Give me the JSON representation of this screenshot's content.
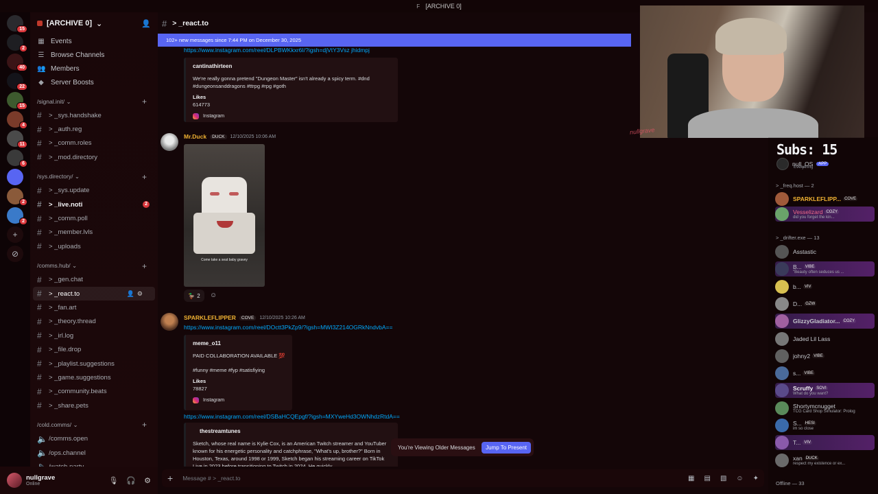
{
  "window": {
    "title": "[ARCHIVE 0]",
    "logo": "F"
  },
  "colors": {
    "accent": "#5865f2",
    "mention": "#da373c",
    "link": "#00a8fc"
  },
  "rail": {
    "servers": [
      {
        "badge": "15",
        "color": "#2a2a2e"
      },
      {
        "badge": "2",
        "color": "#1e1e22"
      },
      {
        "badge": "40",
        "color": "#3a1416"
      },
      {
        "badge": "22",
        "color": "#14141a"
      },
      {
        "badge": "15",
        "color": "#3d5a2e"
      },
      {
        "badge": "4",
        "color": "#7a3b2a"
      },
      {
        "badge": "11",
        "color": "#4a4a4a"
      },
      {
        "badge": "6",
        "color": "#3a3a3a"
      },
      {
        "badge": "",
        "color": "#5865f2"
      },
      {
        "badge": "2",
        "color": "#8a5a3a"
      },
      {
        "badge": "2",
        "color": "#3a7ac9"
      }
    ]
  },
  "sidebar": {
    "server_name": "[ARCHIVE 0]",
    "nav": [
      {
        "label": "Events",
        "icon": "calendar-icon"
      },
      {
        "label": "Browse Channels",
        "icon": "browse-icon"
      },
      {
        "label": "Members",
        "icon": "members-icon"
      },
      {
        "label": "Server Boosts",
        "icon": "boost-icon"
      }
    ],
    "categories": [
      {
        "name": "/signal.init/",
        "channels": [
          {
            "name": "> _sys.handshake",
            "type": "text"
          },
          {
            "name": "> _auth.reg",
            "type": "text"
          },
          {
            "name": "> _comm.roles",
            "type": "text"
          },
          {
            "name": "> _mod.directory",
            "type": "text"
          }
        ]
      },
      {
        "name": "/sys.directory/",
        "channels": [
          {
            "name": "> _sys.update",
            "type": "text"
          },
          {
            "name": "> _live.noti",
            "type": "text",
            "bold": true,
            "mention": "2"
          },
          {
            "name": "> _comm.poll",
            "type": "text"
          },
          {
            "name": "> _member.lvls",
            "type": "text"
          },
          {
            "name": "> _uploads",
            "type": "text"
          }
        ]
      },
      {
        "name": "/comms.hub/",
        "channels": [
          {
            "name": "> _gen.chat",
            "type": "text"
          },
          {
            "name": "> _react.to",
            "type": "text",
            "active": true
          },
          {
            "name": "> _fan.art",
            "type": "text"
          },
          {
            "name": "> _theory.thread",
            "type": "text"
          },
          {
            "name": "> _irl.log",
            "type": "text"
          },
          {
            "name": "> _file.drop",
            "type": "text"
          },
          {
            "name": "> _playlist.suggestions",
            "type": "text"
          },
          {
            "name": "> _game.suggestions",
            "type": "text"
          },
          {
            "name": "> _community.beats",
            "type": "text"
          },
          {
            "name": "> _share.pets",
            "type": "text"
          }
        ]
      },
      {
        "name": "/cold.comms/",
        "channels": [
          {
            "name": "/comms.open",
            "type": "voice"
          },
          {
            "name": "/ops.channel",
            "type": "voice"
          },
          {
            "name": "/watch.party",
            "type": "voice"
          }
        ]
      }
    ]
  },
  "user": {
    "name": "nullgrave",
    "status": "Online"
  },
  "chat": {
    "channel": "> _react.to",
    "new_banner": "102+ new messages since 7:44 PM on December 30, 2025",
    "composer_placeholder": "Message # > _react.to",
    "older_text": "You're Viewing Older Messages",
    "jump_label": "Jump To Present",
    "msg1": {
      "link": "https://www.instagram.com/reel/DLPBWKkxr6I/?igsh=djVtY3Vsz jhidmpj",
      "embed_author": "cantinathirteen",
      "embed_desc": "We're really gonna pretend \"Dungeon Master\" isn't already a spicy term. #dnd #dungeonsanddragons #ttrpg #rpg #goth",
      "field_name": "Likes",
      "field_value": "614773",
      "footer": "Instagram"
    },
    "msg2": {
      "author": "Mr.Duck",
      "tag": "DUCK",
      "time": "12/10/2025 10:06 AM",
      "caption": "Come take a seat baby gravey",
      "reaction_count": "2"
    },
    "msg3": {
      "author": "SPARKLEFLIPPER",
      "tag": "COVE",
      "time": "12/10/2025 10:26 AM",
      "link": "https://www.instagram.com/reel/DOctt3PkZp9/?igsh=MWI3Z214OGRkNndvbA==",
      "embed_author": "meme_o11",
      "embed_desc": "PAID COLLABORATION AVAILABLE 💯",
      "embed_desc2": "#funny #meme #fyp #satisfiying",
      "field_name": "Likes",
      "field_value": "78827",
      "footer": "Instagram",
      "link2": "https://www.instagram.com/reel/DSBaHCQEpgf/?igsh=MXYweHd3OWNhdzRtdA==",
      "embed2_author": "thestreamtunes",
      "embed2_desc": "Sketch, whose real name is Kylie Cox, is an American Twitch streamer and YouTuber known for his energetic personality and catchphrase, \"What's up, brother?\" Born in Houston, Texas, around 1998 or 1999, Sketch began his streaming career on TikTok Live in 2023 before transitioning to Twitch in 2024. He quickly"
    }
  },
  "overlay": {
    "subs_label": "Subs: 15",
    "watermark": "nullgrave"
  },
  "members": {
    "bot": {
      "name": "null_OS",
      "tag": "APP",
      "activity": "Everything"
    },
    "group1": "> _freq.host — 2",
    "host_members": [
      {
        "name": "SPARKLEFLIPP...",
        "tag": "COVE",
        "status": "",
        "color": "#f0b232",
        "bold": true,
        "hl": false,
        "av": "#a05a3a"
      },
      {
        "name": "Vesselizard",
        "tag": "COZY",
        "status": "did you forget the kin...",
        "color": "#f06a8a",
        "bold": false,
        "hl": true,
        "av": "#6aa36a"
      }
    ],
    "group2": "> _drifter.exe — 13",
    "drifter_members": [
      {
        "name": "Asstastic",
        "tag": "",
        "status": "",
        "color": "#c5c8cd",
        "bold": false,
        "hl": false,
        "av": "#555"
      },
      {
        "name": "B...",
        "tag": "VIBE",
        "status": "\"Beauty often seduces us ...",
        "color": "#c5c8cd",
        "bold": false,
        "hl": true,
        "av": "#3a3a5a"
      },
      {
        "name": "b...",
        "tag": "VIV",
        "status": "",
        "color": "#c5c8cd",
        "bold": false,
        "hl": false,
        "av": "#d8c050"
      },
      {
        "name": "D...",
        "tag": "GZW",
        "status": "",
        "color": "#c5c8cd",
        "bold": false,
        "hl": false,
        "av": "#888"
      },
      {
        "name": "GlizzyGladiator...",
        "tag": "COZY",
        "status": "",
        "color": "#c5c8cd",
        "bold": true,
        "hl": true,
        "av": "#a060a0"
      },
      {
        "name": "Jaded Lil Lass",
        "tag": "",
        "status": "",
        "color": "#c5c8cd",
        "bold": false,
        "hl": false,
        "av": "#777"
      },
      {
        "name": "johny2",
        "tag": "VIBE",
        "status": "",
        "color": "#c5c8cd",
        "bold": false,
        "hl": false,
        "av": "#606060"
      },
      {
        "name": "s...",
        "tag": "VIBE",
        "status": "",
        "color": "#c5c8cd",
        "bold": false,
        "hl": false,
        "av": "#4a6a9a"
      },
      {
        "name": "Scruffy",
        "tag": "SOVI",
        "status": "What do you want?",
        "color": "#f2f3f5",
        "bold": true,
        "hl": true,
        "av": "#5a4a8a"
      },
      {
        "name": "Shortymcnugget",
        "tag": "",
        "status": "TCG Card Shop Simulator: Prolog",
        "color": "#c5c8cd",
        "bold": false,
        "hl": false,
        "av": "#5a8a5a"
      },
      {
        "name": "S...",
        "tag": "HESI",
        "status": "im so close",
        "color": "#c5c8cd",
        "bold": false,
        "hl": false,
        "av": "#3a6aaa"
      },
      {
        "name": "T...",
        "tag": "VIV",
        "status": "",
        "color": "#c5c8cd",
        "bold": false,
        "hl": true,
        "av": "#8a5aaa"
      },
      {
        "name": "xan",
        "tag": "DUCK",
        "status": "respect my existence or ex...",
        "color": "#c5c8cd",
        "bold": false,
        "hl": false,
        "av": "#6a6a6a"
      }
    ],
    "offline": "Offline — 33"
  }
}
